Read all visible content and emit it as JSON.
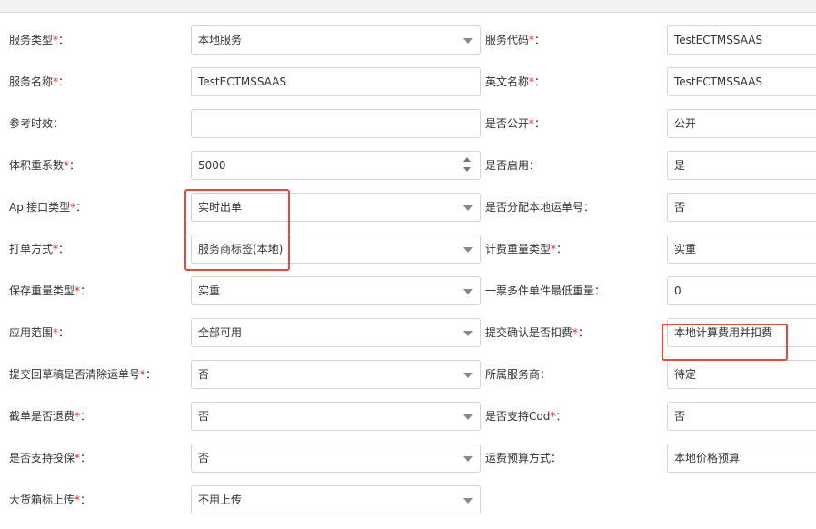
{
  "form": {
    "rows": [
      {
        "left": {
          "label": "服务类型",
          "required": "*",
          "value": "本地服务",
          "type": "select"
        },
        "right": {
          "label": "服务代码",
          "required": "*",
          "value": "TestECTMSSAAS"
        }
      },
      {
        "left": {
          "label": "服务名称",
          "required": "*",
          "value": "TestECTMSSAAS",
          "type": "text"
        },
        "right": {
          "label": "英文名称",
          "required": "*",
          "value": "TestECTMSSAAS"
        }
      },
      {
        "left": {
          "label": "参考时效",
          "required": "",
          "value": "",
          "type": "text"
        },
        "right": {
          "label": "是否公开",
          "required": "*",
          "value": "公开"
        }
      },
      {
        "left": {
          "label": "体积重系数",
          "required": "*",
          "value": "5000",
          "type": "number"
        },
        "right": {
          "label": "是否启用",
          "required": "",
          "value": "是"
        }
      },
      {
        "left": {
          "label": "Api接口类型",
          "required": "*",
          "value": "实时出单",
          "type": "select"
        },
        "right": {
          "label": "是否分配本地运单号",
          "required": "",
          "value": "否"
        }
      },
      {
        "left": {
          "label": "打单方式",
          "required": "*",
          "value": "服务商标签(本地)",
          "type": "select"
        },
        "right": {
          "label": "计费重量类型",
          "required": "*",
          "value": "实重"
        }
      },
      {
        "left": {
          "label": "保存重量类型",
          "required": "*",
          "value": "实重",
          "type": "select"
        },
        "right": {
          "label": "一票多件单件最低重量",
          "required": "",
          "value": "0"
        }
      },
      {
        "left": {
          "label": "应用范围",
          "required": "*",
          "value": "全部可用",
          "type": "select"
        },
        "right": {
          "label": "提交确认是否扣费",
          "required": "*",
          "value": "本地计算费用并扣费"
        }
      },
      {
        "left": {
          "label": "提交回草稿是否清除运单号",
          "required": "*",
          "value": "否",
          "type": "select"
        },
        "right": {
          "label": "所属服务商",
          "required": "",
          "value": "待定"
        }
      },
      {
        "left": {
          "label": "截单是否退费",
          "required": "*",
          "value": "否",
          "type": "select"
        },
        "right": {
          "label": "是否支持Cod",
          "required": "*",
          "value": "否"
        }
      },
      {
        "left": {
          "label": "是否支持投保",
          "required": "*",
          "value": "否",
          "type": "select"
        },
        "right": {
          "label": "运费预算方式",
          "required": "",
          "value": "本地价格预算"
        }
      },
      {
        "left": {
          "label": "大货箱标上传",
          "required": "*",
          "value": "不用上传",
          "type": "select"
        },
        "right": null
      }
    ]
  },
  "colors": {
    "required": "#e2231a",
    "highlight": "#e8473a",
    "border": "#d5d5d5"
  }
}
